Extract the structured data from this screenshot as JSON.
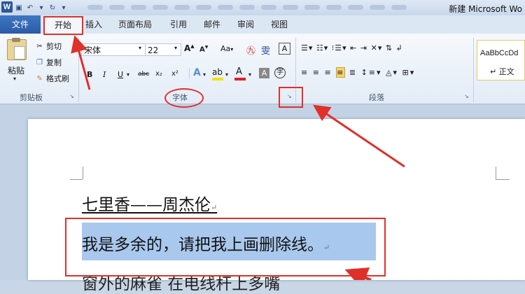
{
  "window": {
    "title": "新建 Microsoft Wo"
  },
  "tabs": {
    "file": "文件",
    "home": "开始",
    "insert": "插入",
    "layout": "页面布局",
    "references": "引用",
    "mailings": "邮件",
    "review": "审阅",
    "view": "视图"
  },
  "clipboard": {
    "paste": "粘贴",
    "cut": "剪切",
    "copy": "复制",
    "format_painter": "格式刷",
    "group": "剪贴板"
  },
  "font": {
    "name": "宋体",
    "size": "22",
    "group": "字体",
    "grow": "A",
    "shrink": "A",
    "case": "Aa",
    "bold": "B",
    "italic": "I",
    "underline": "U",
    "strike": "abc",
    "sub": "x₂",
    "sup": "x²"
  },
  "paragraph": {
    "group": "段落"
  },
  "styles": {
    "preview": "AaBbCcDd",
    "normal": "↵ 正文"
  },
  "document": {
    "line1": "七里香——周杰伦",
    "line2": "我是多余的，请把我上画删除线。",
    "line3": "窗外的麻雀 在电线杆上多嘴"
  },
  "annotation_color": "#e0302a",
  "selection_color": "#a9c8ee"
}
